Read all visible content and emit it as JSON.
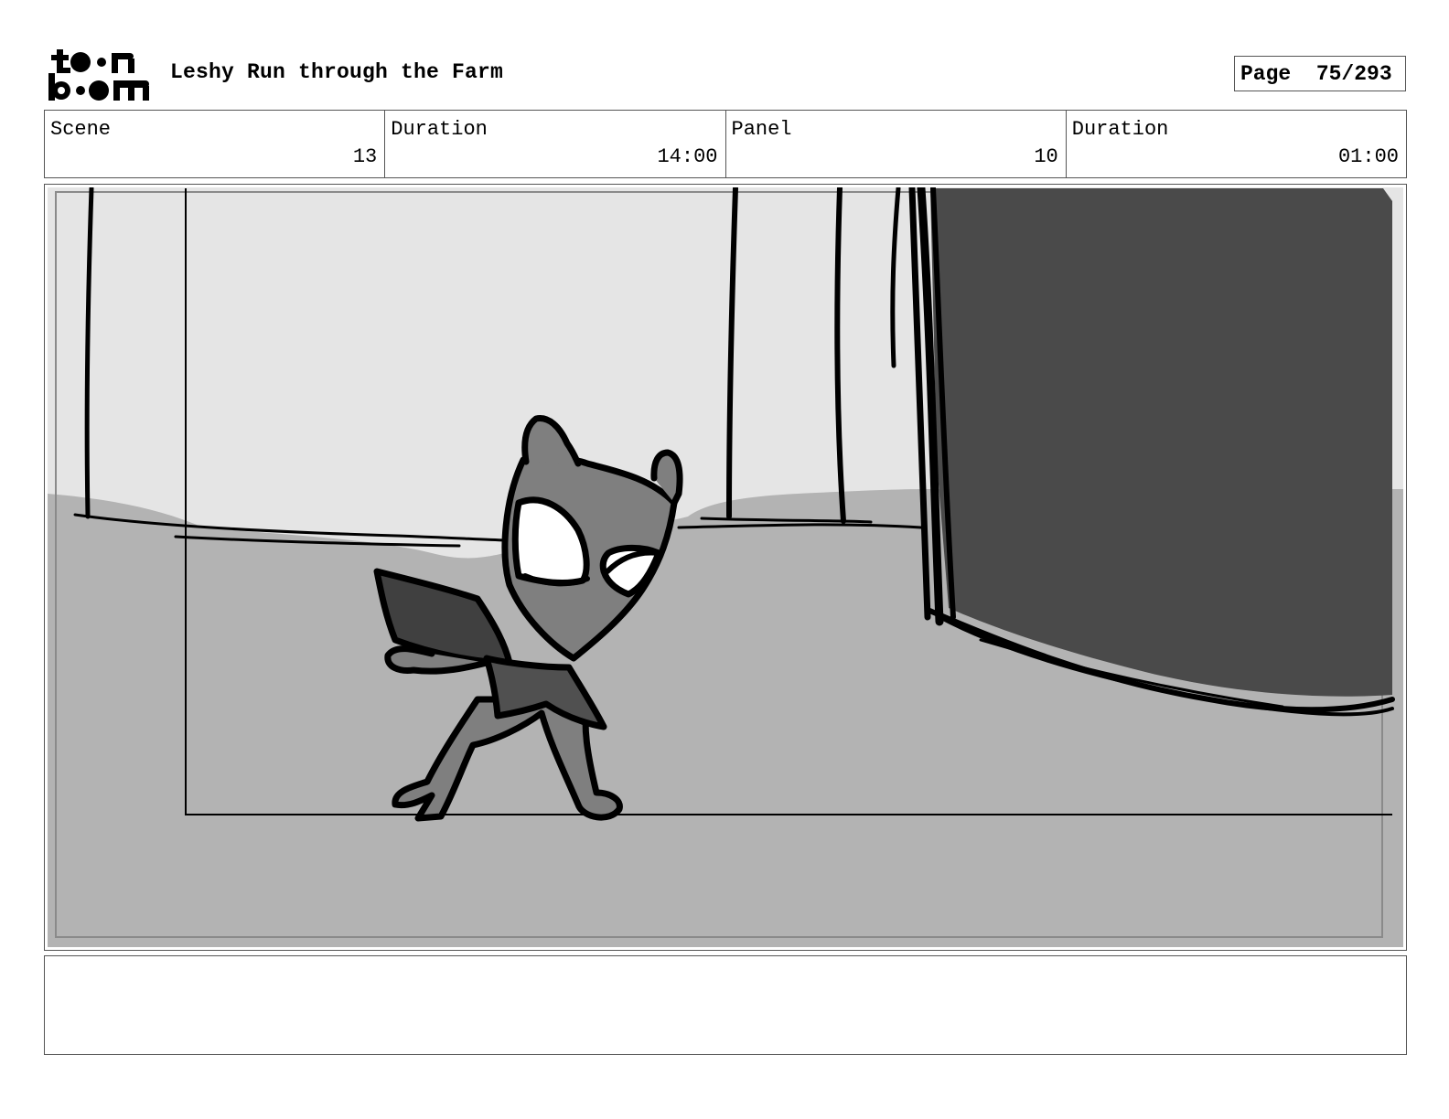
{
  "header": {
    "logo_text": "toon boom",
    "title": "Leshy Run through the Farm",
    "page_label": "Page",
    "page_value": "75/293"
  },
  "info": {
    "scene_label": "Scene",
    "scene_value": "13",
    "scene_duration_label": "Duration",
    "scene_duration_value": "14:00",
    "panel_label": "Panel",
    "panel_value": "10",
    "panel_duration_label": "Duration",
    "panel_duration_value": "01:00"
  },
  "notes": {
    "text": ""
  },
  "colors": {
    "sky": "#e5e5e5",
    "ground": "#b3b3b3",
    "dark_wall": "#4a4a4a",
    "character": "#7f7f7f",
    "border": "#555555"
  }
}
